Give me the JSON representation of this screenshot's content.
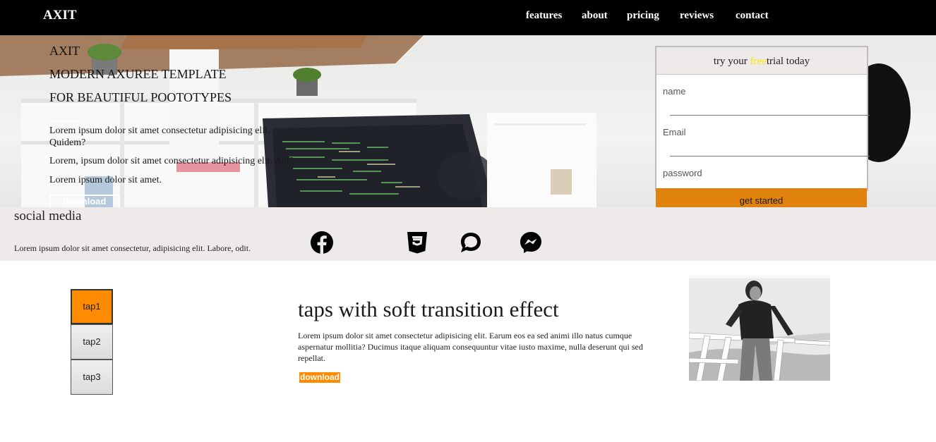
{
  "navbar": {
    "brand": "AXIT",
    "links": [
      "features",
      "about",
      "pricing",
      "reviews",
      "contact"
    ]
  },
  "hero": {
    "title": "AXIT",
    "subtitle_line1": "MODERN AXUREE TEMPLATE",
    "subtitle_line2": "FOR BEAUTIFUL POOTOTYPES",
    "paragraph1": "Lorem ipsum dolor sit amet consectetur adipisicing elit. Quidem?",
    "paragraph2": "Lorem, ipsum dolor sit amet consectetur adipisicing elit. Aut?",
    "paragraph3": "Lorem ipsum dolor sit amet.",
    "download_label": "download"
  },
  "signup": {
    "heading_before": "try your ",
    "heading_highlight": "free",
    "heading_after": "trial today",
    "name_label": "name",
    "email_label": "Email",
    "password_label": "password",
    "submit_label": "get started"
  },
  "social": {
    "title": "social media",
    "text": "Lorem ipsum dolor sit amet consectetur, adipisicing elit. Labore, odit.",
    "icons": [
      "facebook-icon",
      "css3-icon",
      "chat-bubble-icon",
      "messenger-icon"
    ]
  },
  "tabs": {
    "items": [
      "tap1",
      "tap2",
      "tap3"
    ],
    "active_index": 0
  },
  "content": {
    "title": "taps with soft transition effect",
    "text": "Lorem ipsum dolor sit amet consectetur adipisicing elit. Earum eos ea sed animi illo natus cumque aspernatur mollitia? Ducimus itaque aliquam consequuntur vitae iusto maxime, nulla deserunt qui sed repellat.",
    "download_label": "download"
  },
  "colors": {
    "accent_orange": "#ff8c00",
    "button_orange": "#e0820e",
    "highlight_yellow": "#ffe600",
    "navbar_bg": "#000000",
    "social_bg": "#efeaea"
  }
}
